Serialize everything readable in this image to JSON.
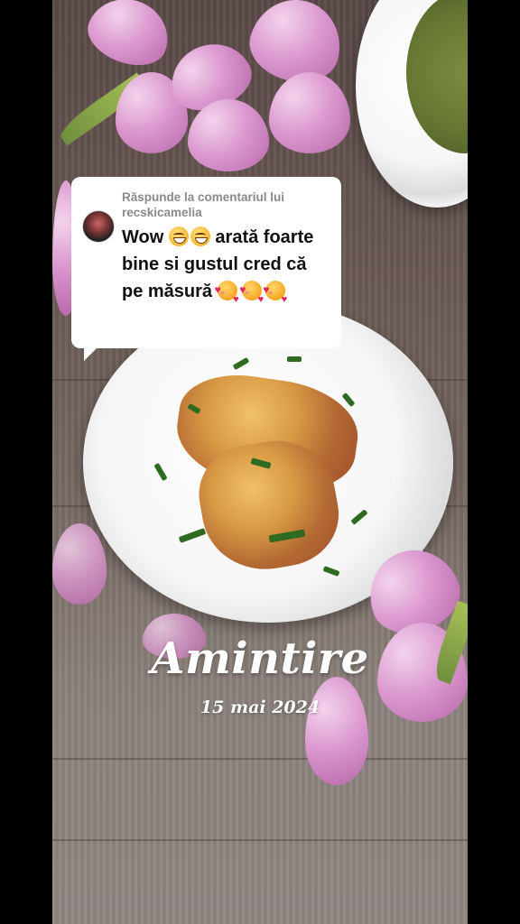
{
  "comment": {
    "reply_header": "Răspunde la comentariul lui recskicamelia",
    "text_part1": "Wow",
    "text_part2": "arată foarte bine si gustul cred că pe măsură",
    "emojis": [
      "grinning-face-icon",
      "grinning-face-icon",
      "smiling-face-with-hearts-icon",
      "smiling-face-with-hearts-icon",
      "smiling-face-with-hearts-icon"
    ]
  },
  "overlay": {
    "title": "Amintire",
    "date": "15 mai 2024"
  },
  "colors": {
    "card_background": "#ffffff",
    "header_gray": "#8a8a8a",
    "text_dark": "#111111",
    "overlay_text": "#ffffff"
  }
}
